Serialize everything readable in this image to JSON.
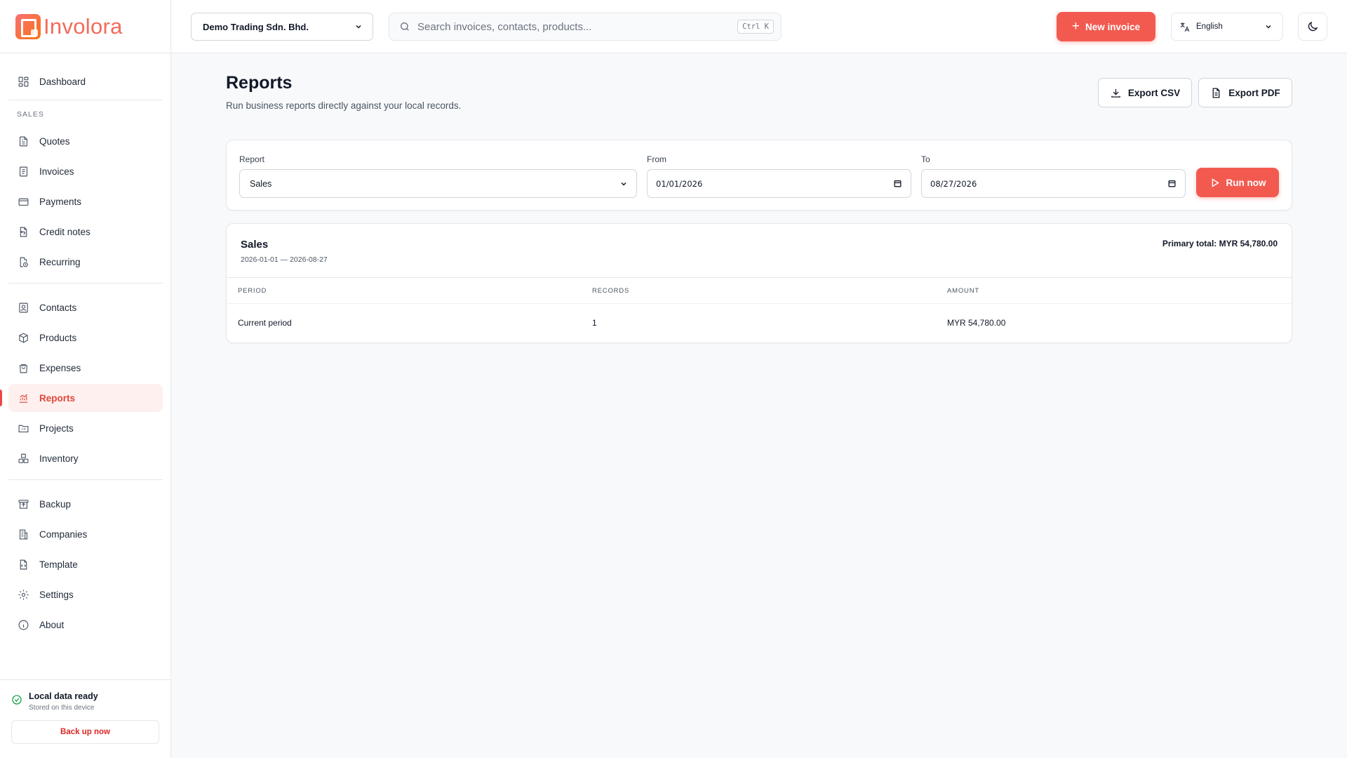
{
  "app": {
    "name": "Involora"
  },
  "sidebar": {
    "dashboard": "Dashboard",
    "section_sales": "SALES",
    "sales_items": [
      "Quotes",
      "Invoices",
      "Payments",
      "Credit notes",
      "Recurring"
    ],
    "items_group2": [
      "Contacts",
      "Products",
      "Expenses",
      "Reports",
      "Projects",
      "Inventory"
    ],
    "items_group3": [
      "Backup",
      "Companies",
      "Template",
      "Settings",
      "About"
    ],
    "active": "Reports",
    "status_title": "Local data ready",
    "status_sub": "Stored on this device",
    "backup_button": "Back up now"
  },
  "topbar": {
    "company": "Demo Trading Sdn. Bhd.",
    "search_placeholder": "Search invoices, contacts, products...",
    "search_shortcut": "Ctrl K",
    "new_invoice": "New invoice",
    "language": "English"
  },
  "page": {
    "title": "Reports",
    "subtitle": "Run business reports directly against your local records.",
    "export_csv": "Export CSV",
    "export_pdf": "Export PDF"
  },
  "filters": {
    "report_label": "Report",
    "report_value": "Sales",
    "from_label": "From",
    "from_value": "01/01/2026",
    "to_label": "To",
    "to_value": "08/27/2026",
    "run_button": "Run now"
  },
  "result": {
    "title": "Sales",
    "range": "2026-01-01 — 2026-08-27",
    "primary_total": "Primary total: MYR 54,780.00",
    "columns": [
      "PERIOD",
      "RECORDS",
      "AMOUNT"
    ],
    "rows": [
      {
        "period": "Current period",
        "records": "1",
        "amount": "MYR 54,780.00"
      }
    ]
  },
  "colors": {
    "accent": "#f25a50",
    "active_bg": "#fdf0ee",
    "success": "#16a34a"
  }
}
